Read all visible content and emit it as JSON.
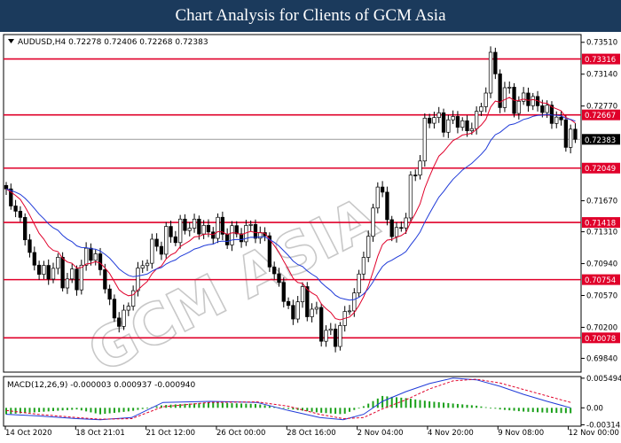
{
  "banner": {
    "title": "Chart Analysis for Clients of GCM Asia"
  },
  "colors": {
    "banner_bg": "#1b3a5c",
    "level_line": "#e0002a",
    "ma_fast": "#e0002a",
    "ma_slow": "#1f3ad8",
    "macd_hist": "#1aa01a",
    "macd_main": "#1f3ad8",
    "macd_signal": "#e0002a"
  },
  "watermark": {
    "text": "GCM ASIA"
  },
  "chart_data": [
    {
      "type": "candlestick",
      "header": "AUDUSD,H4  0.72278 0.72406 0.72268 0.72383",
      "ylim": [
        0.6968,
        0.736
      ],
      "y_ticks": [
        "0.73510",
        "0.73140",
        "0.72770",
        "0.71670",
        "0.71310",
        "0.70940",
        "0.70570",
        "0.70200",
        "0.69840"
      ],
      "x_ticks": [
        "14 Oct 2020",
        "18 Oct 21:01",
        "21 Oct 12:00",
        "26 Oct 00:00",
        "28 Oct 16:00",
        "2 Nov 04:00",
        "4 Nov 20:00",
        "9 Nov 08:00",
        "12 Nov 00:00"
      ],
      "levels": [
        {
          "label": "0.73316",
          "value": 0.73316
        },
        {
          "label": "0.72667",
          "value": 0.72667
        },
        {
          "label": "0.72049",
          "value": 0.72049
        },
        {
          "label": "0.71418",
          "value": 0.71418
        },
        {
          "label": "0.70754",
          "value": 0.70754
        },
        {
          "label": "0.70078",
          "value": 0.70078
        }
      ],
      "current_price": {
        "label": "0.72383",
        "value": 0.72383
      },
      "close_path": [
        [
          0,
          0.7175
        ],
        [
          8,
          0.715
        ],
        [
          15,
          0.7105
        ],
        [
          22,
          0.708
        ],
        [
          30,
          0.709
        ],
        [
          37,
          0.708
        ],
        [
          43,
          0.707
        ],
        [
          50,
          0.71
        ],
        [
          56,
          0.711
        ],
        [
          64,
          0.706
        ],
        [
          72,
          0.702
        ],
        [
          80,
          0.706
        ],
        [
          88,
          0.71
        ],
        [
          96,
          0.7115
        ],
        [
          104,
          0.7125
        ],
        [
          112,
          0.7135
        ],
        [
          120,
          0.714
        ],
        [
          127,
          0.713
        ],
        [
          135,
          0.7135
        ],
        [
          142,
          0.7125
        ],
        [
          150,
          0.713
        ],
        [
          158,
          0.7135
        ],
        [
          164,
          0.7125
        ],
        [
          170,
          0.7085
        ],
        [
          176,
          0.706
        ],
        [
          182,
          0.703
        ],
        [
          188,
          0.706
        ],
        [
          194,
          0.704
        ],
        [
          200,
          0.7025
        ],
        [
          206,
          0.7005
        ],
        [
          212,
          0.7015
        ],
        [
          218,
          0.704
        ],
        [
          222,
          0.706
        ],
        [
          225,
          0.708
        ],
        [
          230,
          0.7115
        ],
        [
          234,
          0.716
        ],
        [
          238,
          0.719
        ],
        [
          244,
          0.714
        ],
        [
          248,
          0.712
        ],
        [
          254,
          0.715
        ],
        [
          260,
          0.7195
        ],
        [
          266,
          0.724
        ],
        [
          272,
          0.7275
        ],
        [
          278,
          0.725
        ],
        [
          284,
          0.7265
        ],
        [
          292,
          0.725
        ],
        [
          300,
          0.726
        ],
        [
          306,
          0.73
        ],
        [
          310,
          0.734
        ],
        [
          314,
          0.7285
        ],
        [
          320,
          0.7295
        ],
        [
          326,
          0.7275
        ],
        [
          332,
          0.729
        ],
        [
          340,
          0.7275
        ],
        [
          346,
          0.727
        ],
        [
          352,
          0.7258
        ],
        [
          357,
          0.7245
        ],
        [
          363,
          0.7238
        ]
      ]
    },
    {
      "type": "line",
      "header": "MACD(12,26,9) -0.000003 0.000937 -0.000940",
      "ylim": [
        -0.0034,
        0.0058
      ],
      "y_ticks": [
        "0.005494",
        "0.00",
        "-0.003145"
      ],
      "series": [
        {
          "role": "histogram",
          "x": [
            0,
            20,
            45,
            60,
            80,
            100,
            130,
            160,
            180,
            200,
            215,
            228,
            240,
            255,
            270,
            285,
            300,
            315,
            330,
            345,
            360
          ],
          "values": [
            -0.0012,
            -0.0008,
            -0.0003,
            -0.0012,
            -0.0006,
            0.0005,
            0.001,
            0.0007,
            -0.0002,
            -0.0009,
            -0.0012,
            0.0003,
            0.0022,
            0.0018,
            0.0012,
            0.0008,
            0.0004,
            -0.0003,
            -0.0007,
            -0.0009,
            -0.001
          ]
        },
        {
          "role": "main",
          "x": [
            0,
            20,
            45,
            60,
            80,
            100,
            130,
            160,
            180,
            200,
            215,
            228,
            240,
            255,
            270,
            285,
            300,
            315,
            330,
            345,
            360
          ],
          "values": [
            -0.0012,
            -0.0015,
            -0.002,
            -0.0022,
            -0.0018,
            0.001,
            0.0012,
            0.001,
            -0.0005,
            -0.0018,
            -0.0022,
            -0.0012,
            0.0012,
            0.003,
            0.0045,
            0.0055,
            0.0052,
            0.004,
            0.0025,
            0.0012,
            0.0
          ]
        },
        {
          "role": "signal",
          "x": [
            0,
            20,
            45,
            60,
            80,
            100,
            130,
            160,
            180,
            200,
            215,
            228,
            240,
            255,
            270,
            285,
            300,
            315,
            330,
            345,
            360
          ],
          "values": [
            -0.0005,
            -0.0012,
            -0.0018,
            -0.0021,
            -0.002,
            0.0002,
            0.001,
            0.0011,
            0.0003,
            -0.0012,
            -0.002,
            -0.0018,
            -0.0002,
            0.0015,
            0.0035,
            0.005,
            0.0053,
            0.0046,
            0.0034,
            0.0022,
            0.001
          ]
        }
      ]
    }
  ]
}
